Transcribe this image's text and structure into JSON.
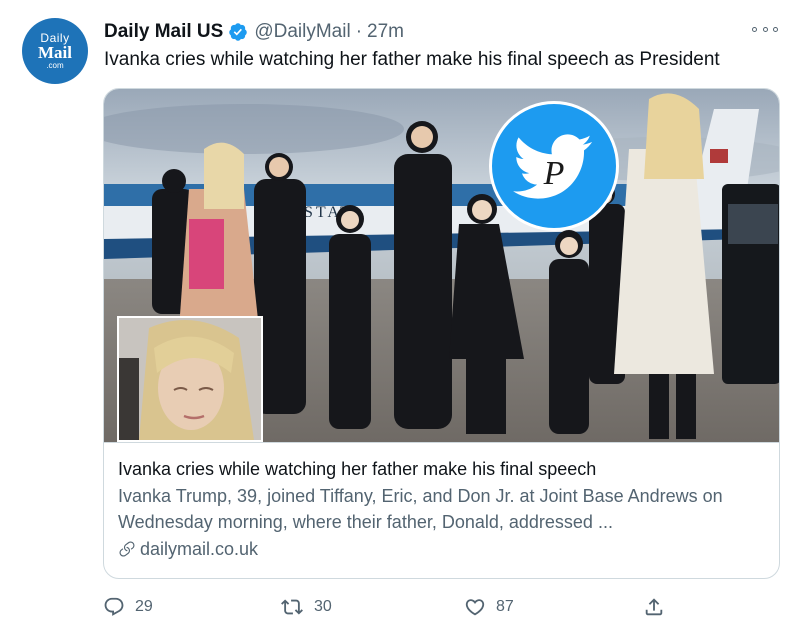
{
  "account": {
    "avatar": {
      "line1": "Daily",
      "line2": "Mail",
      "line3": ".com"
    },
    "name": "Daily Mail US",
    "verified_icon": "verified-badge-icon",
    "handle": "@DailyMail",
    "separator": "·",
    "time": "27m"
  },
  "tweet": {
    "text": "Ivanka cries while watching her father make his final speech as President"
  },
  "card": {
    "watermark_letter": "P",
    "title": "Ivanka cries while watching her father make his final speech",
    "description": "Ivanka Trump, 39, joined Tiffany, Eric, and Don Jr. at Joint Base Andrews on Wednesday morning, where their father, Donald, addressed ...",
    "domain": "dailymail.co.uk",
    "plane_text": "STAT"
  },
  "actions": {
    "reply_count": "29",
    "retweet_count": "30",
    "like_count": "87"
  },
  "colors": {
    "brand_blue": "#1d9bf0",
    "daily_mail_blue": "#1e73b8",
    "secondary_text": "#536471",
    "border": "#cfd9de"
  }
}
